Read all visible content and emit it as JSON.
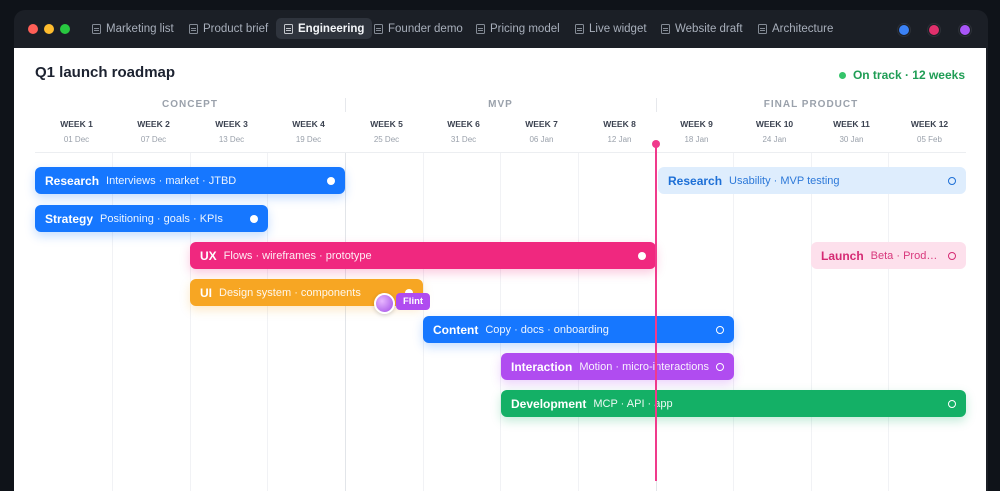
{
  "window": {
    "tabs": [
      {
        "label": "Marketing list",
        "active": false
      },
      {
        "label": "Product brief",
        "active": false
      },
      {
        "label": "Engineering",
        "active": true
      },
      {
        "label": "Founder demo",
        "active": false
      },
      {
        "label": "Pricing model",
        "active": false
      },
      {
        "label": "Live widget",
        "active": false
      },
      {
        "label": "Website draft",
        "active": false
      },
      {
        "label": "Architecture",
        "active": false
      }
    ],
    "presence_colors": [
      "#3b82f6",
      "#e1306c",
      "#a855f7"
    ],
    "traffic_lights": [
      "#ff5f57",
      "#febc2e",
      "#28c840"
    ]
  },
  "roadmap": {
    "title": "Q1 launch roadmap",
    "status": "On track · 12 weeks",
    "phases": [
      "CONCEPT",
      "MVP",
      "FINAL PRODUCT"
    ],
    "weeks": [
      {
        "label": "WEEK 1",
        "date": "01 Dec"
      },
      {
        "label": "WEEK 2",
        "date": "07 Dec"
      },
      {
        "label": "WEEK 3",
        "date": "13 Dec"
      },
      {
        "label": "WEEK 4",
        "date": "19 Dec"
      },
      {
        "label": "WEEK 5",
        "date": "25 Dec"
      },
      {
        "label": "WEEK 6",
        "date": "31 Dec"
      },
      {
        "label": "WEEK 7",
        "date": "06 Jan"
      },
      {
        "label": "WEEK 8",
        "date": "12 Jan"
      },
      {
        "label": "WEEK 9",
        "date": "18 Jan"
      },
      {
        "label": "WEEK 10",
        "date": "24 Jan"
      },
      {
        "label": "WEEK 11",
        "date": "30 Jan"
      },
      {
        "label": "WEEK 12",
        "date": "05 Feb"
      }
    ],
    "tasks": [
      {
        "title": "Research",
        "subtitle": "Interviews · market · JTBD"
      },
      {
        "title": "Research",
        "subtitle": "Usability · MVP testing"
      },
      {
        "title": "Strategy",
        "subtitle": "Positioning · goals · KPIs"
      },
      {
        "title": "UX",
        "subtitle": "Flows · wireframes · prototype"
      },
      {
        "title": "Launch",
        "subtitle": "Beta · Product Hunt"
      },
      {
        "title": "UI",
        "subtitle": "Design system · components"
      },
      {
        "title": "Content",
        "subtitle": "Copy · docs · onboarding"
      },
      {
        "title": "Interaction",
        "subtitle": "Motion · micro-interactions"
      },
      {
        "title": "Development",
        "subtitle": "MCP · API · app"
      }
    ],
    "collaborator": "Flint"
  }
}
